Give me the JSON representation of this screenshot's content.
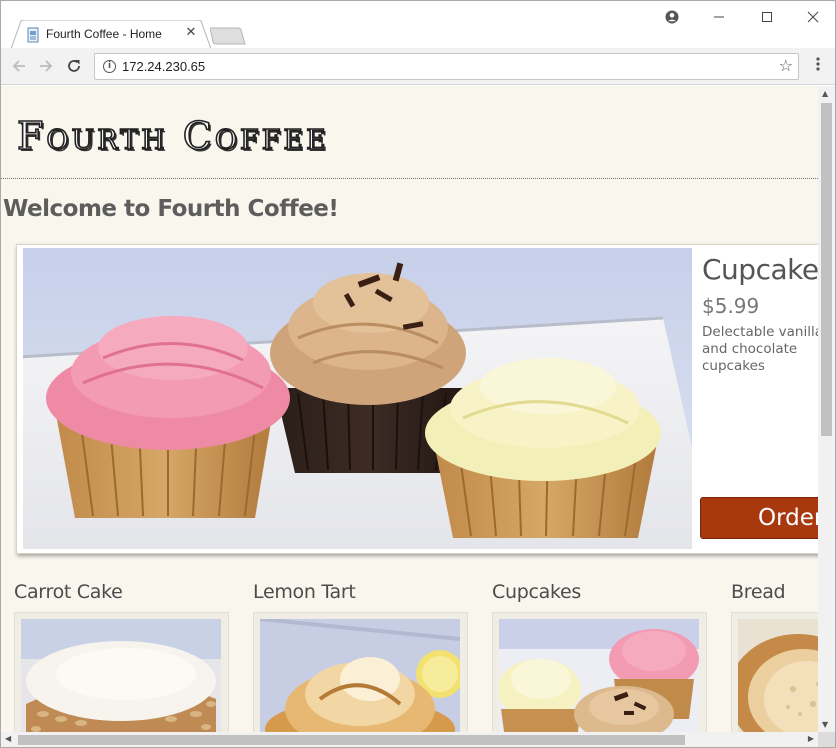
{
  "browser": {
    "tab_title": "Fourth Coffee - Home",
    "url": "172.24.230.65",
    "icons": {
      "favicon": "page-favicon-icon",
      "tab_close": "close-icon",
      "profile": "account-icon",
      "back": "arrow-left-icon",
      "forward": "arrow-right-icon",
      "reload": "reload-icon",
      "info": "info-icon",
      "bookmark": "star-icon",
      "menu": "more-vert-icon"
    }
  },
  "site": {
    "logo": "Fourth Coffee",
    "welcome": "Welcome to Fourth Coffee!",
    "featured": {
      "name": "Cupcakes",
      "price": "$5.99",
      "description": "Delectable vanilla and chocolate cupcakes",
      "order_label": "Order Now"
    },
    "products": [
      {
        "name": "Carrot Cake"
      },
      {
        "name": "Lemon Tart"
      },
      {
        "name": "Cupcakes"
      },
      {
        "name": "Bread"
      }
    ]
  },
  "colors": {
    "page_bg": "#f9f6ee",
    "accent": "#a8380e",
    "heading": "#5d5d5d"
  }
}
